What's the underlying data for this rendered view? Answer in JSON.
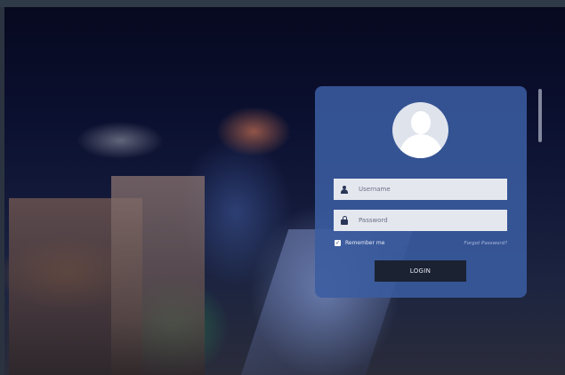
{
  "login_form": {
    "username_placeholder": "Username",
    "password_placeholder": "Password",
    "remember_label": "Remember me",
    "remember_checked": true,
    "forgot_label": "Forgot Password?",
    "login_label": "LOGIN"
  },
  "icons": {
    "avatar": "user-avatar-icon",
    "username": "user-icon",
    "password": "lock-icon",
    "checkbox": "check-icon"
  },
  "colors": {
    "panel": "#3a5ca0",
    "login_button": "#1b2232",
    "input_bg": "#e4e7ee",
    "forgot_link": "#a9b9de"
  }
}
